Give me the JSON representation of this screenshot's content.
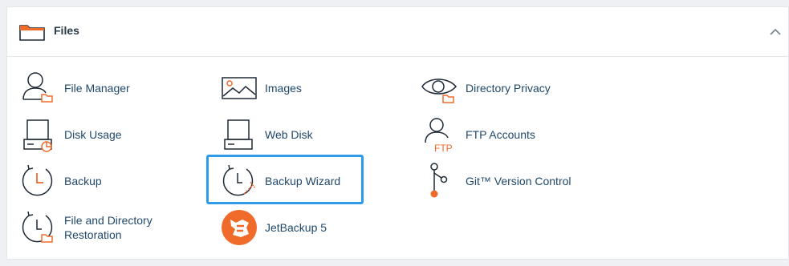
{
  "section": {
    "title": "Files",
    "collapse_icon": "chevron-up-icon",
    "folder_icon": "folder-icon",
    "accent_color": "#f06a2a",
    "link_color": "#20486b",
    "highlight_color": "#2e9be6"
  },
  "items": [
    {
      "label": "File Manager",
      "icon": "file-manager-icon"
    },
    {
      "label": "Images",
      "icon": "images-icon"
    },
    {
      "label": "Directory Privacy",
      "icon": "directory-privacy-icon"
    },
    {
      "label": "Disk Usage",
      "icon": "disk-usage-icon"
    },
    {
      "label": "Web Disk",
      "icon": "web-disk-icon"
    },
    {
      "label": "FTP Accounts",
      "icon": "ftp-accounts-icon"
    },
    {
      "label": "Backup",
      "icon": "backup-icon"
    },
    {
      "label": "Backup Wizard",
      "icon": "backup-wizard-icon",
      "highlighted": true
    },
    {
      "label": "Git™ Version Control",
      "icon": "git-icon"
    },
    {
      "label": "File and Directory Restoration",
      "icon": "restoration-icon"
    },
    {
      "label": "JetBackup 5",
      "icon": "jetbackup-icon"
    }
  ]
}
